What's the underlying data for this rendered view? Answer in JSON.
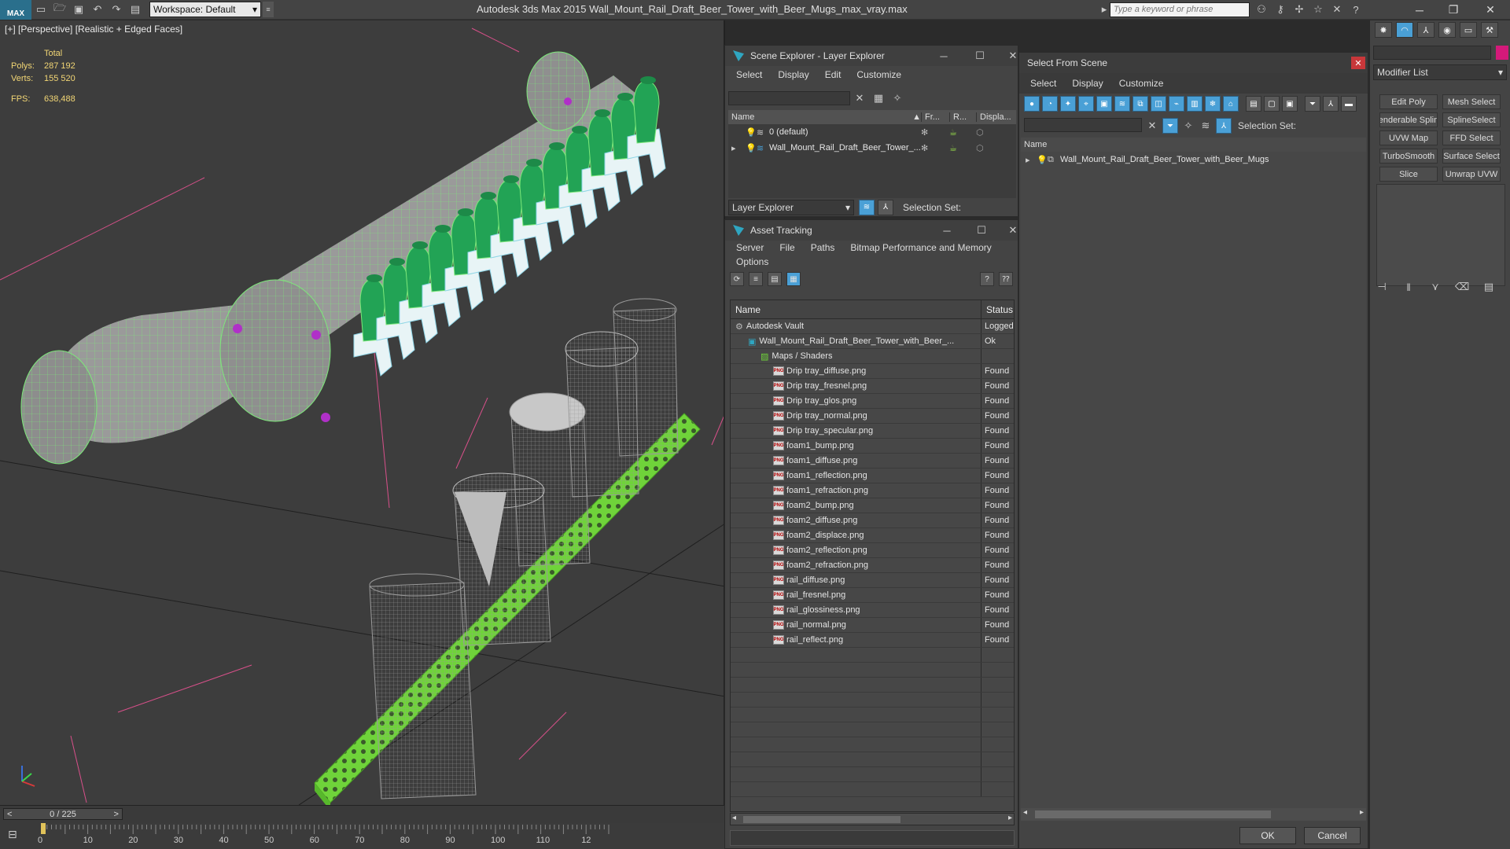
{
  "app": {
    "logo_text": "MAX",
    "workspace_label": "Workspace: Default",
    "title": "Autodesk 3ds Max  2015      Wall_Mount_Rail_Draft_Beer_Tower_with_Beer_Mugs_max_vray.max",
    "search_placeholder": "Type a keyword or phrase"
  },
  "viewport": {
    "label": "[+] [Perspective] [Realistic + Edged Faces]",
    "stats": {
      "total_label": "Total",
      "polys_label": "Polys:",
      "polys_value": "287 192",
      "verts_label": "Verts:",
      "verts_value": "155 520",
      "fps_label": "FPS:",
      "fps_value": "638,488"
    }
  },
  "timeline": {
    "frame": "0 / 225",
    "ticks": [
      "0",
      "10",
      "20",
      "30",
      "40",
      "50",
      "60",
      "70",
      "80",
      "90",
      "100",
      "110",
      "12"
    ]
  },
  "scene_explorer": {
    "title": "Scene Explorer - Layer Explorer",
    "menu": [
      "Select",
      "Display",
      "Edit",
      "Customize"
    ],
    "columns": [
      "Name",
      "Fr...",
      "R...",
      "Displa..."
    ],
    "rows": [
      "0 (default)",
      "Wall_Mount_Rail_Draft_Beer_Tower_..."
    ],
    "footer_dropdown": "Layer Explorer",
    "selection_set_label": "Selection Set:"
  },
  "asset_tracking": {
    "title": "Asset Tracking",
    "menu": [
      "Server",
      "File",
      "Paths",
      "Bitmap Performance and Memory"
    ],
    "menu2": [
      "Options"
    ],
    "columns": [
      "Name",
      "Status"
    ],
    "rows": [
      {
        "name": "Autodesk Vault",
        "status": "Logged",
        "level": 0
      },
      {
        "name": "Wall_Mount_Rail_Draft_Beer_Tower_with_Beer_...",
        "status": "Ok",
        "level": 1
      },
      {
        "name": "Maps / Shaders",
        "status": "",
        "level": 2
      },
      {
        "name": "Drip tray_diffuse.png",
        "status": "Found",
        "level": 3
      },
      {
        "name": "Drip tray_fresnel.png",
        "status": "Found",
        "level": 3
      },
      {
        "name": "Drip tray_glos.png",
        "status": "Found",
        "level": 3
      },
      {
        "name": "Drip tray_normal.png",
        "status": "Found",
        "level": 3
      },
      {
        "name": "Drip tray_specular.png",
        "status": "Found",
        "level": 3
      },
      {
        "name": "foam1_bump.png",
        "status": "Found",
        "level": 3
      },
      {
        "name": "foam1_diffuse.png",
        "status": "Found",
        "level": 3
      },
      {
        "name": "foam1_reflection.png",
        "status": "Found",
        "level": 3
      },
      {
        "name": "foam1_refraction.png",
        "status": "Found",
        "level": 3
      },
      {
        "name": "foam2_bump.png",
        "status": "Found",
        "level": 3
      },
      {
        "name": "foam2_diffuse.png",
        "status": "Found",
        "level": 3
      },
      {
        "name": "foam2_displace.png",
        "status": "Found",
        "level": 3
      },
      {
        "name": "foam2_reflection.png",
        "status": "Found",
        "level": 3
      },
      {
        "name": "foam2_refraction.png",
        "status": "Found",
        "level": 3
      },
      {
        "name": "rail_diffuse.png",
        "status": "Found",
        "level": 3
      },
      {
        "name": "rail_fresnel.png",
        "status": "Found",
        "level": 3
      },
      {
        "name": "rail_glossiness.png",
        "status": "Found",
        "level": 3
      },
      {
        "name": "rail_normal.png",
        "status": "Found",
        "level": 3
      },
      {
        "name": "rail_reflect.png",
        "status": "Found",
        "level": 3
      }
    ]
  },
  "select_from_scene": {
    "title": "Select From Scene",
    "menu": [
      "Select",
      "Display",
      "Customize"
    ],
    "selection_set_label": "Selection Set:",
    "name_header": "Name",
    "item": "Wall_Mount_Rail_Draft_Beer_Tower_with_Beer_Mugs",
    "ok": "OK",
    "cancel": "Cancel"
  },
  "command_panel": {
    "modifier_list": "Modifier List",
    "buttons": [
      "Edit Poly",
      "Mesh Select",
      "enderable Splin",
      "SplineSelect",
      "UVW Map",
      "FFD Select",
      "TurboSmooth",
      "Surface Select",
      "Slice",
      "Unwrap UVW"
    ]
  },
  "colors": {
    "wire_green": "#7de87a",
    "tap_green": "#22a355",
    "tray_green": "#6fd33a",
    "accent_blue": "#4aa0d6",
    "object_color": "#d4197a"
  }
}
